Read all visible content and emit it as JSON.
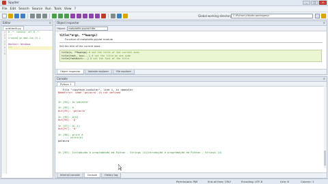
{
  "window": {
    "title": "Spyder",
    "controls": [
      "_",
      "□",
      "✕"
    ]
  },
  "menu": [
    "File",
    "Edit",
    "Search",
    "Source",
    "Run",
    "Tools",
    "View",
    "?"
  ],
  "toolbar": {
    "wd_label": "Global working directory",
    "wd_path": "C:\\Python\\Lib\\site-packages\\s",
    "icons": [
      "new-file-icon",
      "open-file-icon",
      "save-icon",
      "save-all-icon",
      "run-icon",
      "debug-icon",
      "stop-icon",
      "settings-icon"
    ]
  },
  "editor": {
    "pane_title": "Editor",
    "tab": "untitled0.py",
    "line_numbers": [
      "1",
      "2",
      "3",
      "4",
      "5",
      "6",
      "7",
      "8"
    ],
    "lines": [
      "# -*- coding: utf-8 -*-",
      "\"\"\"",
      "Created on Wed Jun 19 2",
      "",
      "@author: Windows",
      "\"\"\"",
      "",
      ""
    ]
  },
  "inspector": {
    "pane_title": "Object inspector",
    "search_label": "Object",
    "search_value": "matplotlib.pyplot.title",
    "signature": "title(*args, **kwargs)",
    "desc": "Function of matplotlib.pyplot module",
    "hr_sub": "Set the title of the current axes.",
    "examples": [
      {
        "code": "title(s, **kwargs)",
        "comment": "# set the title of the current axes"
      },
      {
        "code": "title(text, loc=...)",
        "comment": "# set the title on one side"
      },
      {
        "code": "title(fontdict=...)",
        "comment": "# set the font of the title"
      }
    ],
    "tabs": [
      "Object inspector",
      "Variable explorer",
      "File explorer"
    ]
  },
  "console": {
    "pane_title": "Console",
    "tab": "Python 1",
    "lines": [
      {
        "text": "   File \"<ipython-console>\", line 1, in <module>",
        "c": "t-blk"
      },
      {
        "text": "NameError: name 'palavra' is not defined",
        "c": "t-red"
      },
      {
        "text": "",
        "c": "t-blk"
      },
      {
        "text": "",
        "c": "t-blk"
      },
      {
        "text": "In [94]: A='palavra'",
        "c": "t-grn"
      },
      {
        "text": "",
        "c": "t-blk"
      },
      {
        "text": "In [95]: A",
        "c": "t-grn"
      },
      {
        "text": "Out[95]: 'palavra'",
        "c": "t-red"
      },
      {
        "text": "",
        "c": "t-blk"
      },
      {
        "text": "In [96]: A[0]",
        "c": "t-grn"
      },
      {
        "text": "Out[96]: 'p'",
        "c": "t-red"
      },
      {
        "text": "",
        "c": "t-blk"
      },
      {
        "text": "In [97]: A[-1]",
        "c": "t-grn"
      },
      {
        "text": "Out[97]: 'a'",
        "c": "t-red"
      },
      {
        "text": "",
        "c": "t-blk"
      },
      {
        "text": "In [98]: print A",
        "c": "t-grn"
      },
      {
        "text": "   ...: print(A)",
        "c": "t-grn"
      },
      {
        "text": "palavra",
        "c": "t-blk"
      },
      {
        "text": "",
        "c": "t-blk"
      },
      {
        "text": "",
        "c": "t-blk"
      },
      {
        "text": "",
        "c": "t-blk"
      },
      {
        "text": "In [99]: Introdução à programação em Python - Strings (4)Introdução à programação em Python - Strings (4)",
        "c": "t-grn"
      }
    ],
    "tabs": [
      "Internal console",
      "Console",
      "History log"
    ]
  },
  "status": {
    "permissions": "Permissions: RW",
    "eol": "End-of-lines: CRLF",
    "encoding": "Encoding: UTF-8",
    "line": "Line: 6",
    "column": "Column: 1"
  }
}
